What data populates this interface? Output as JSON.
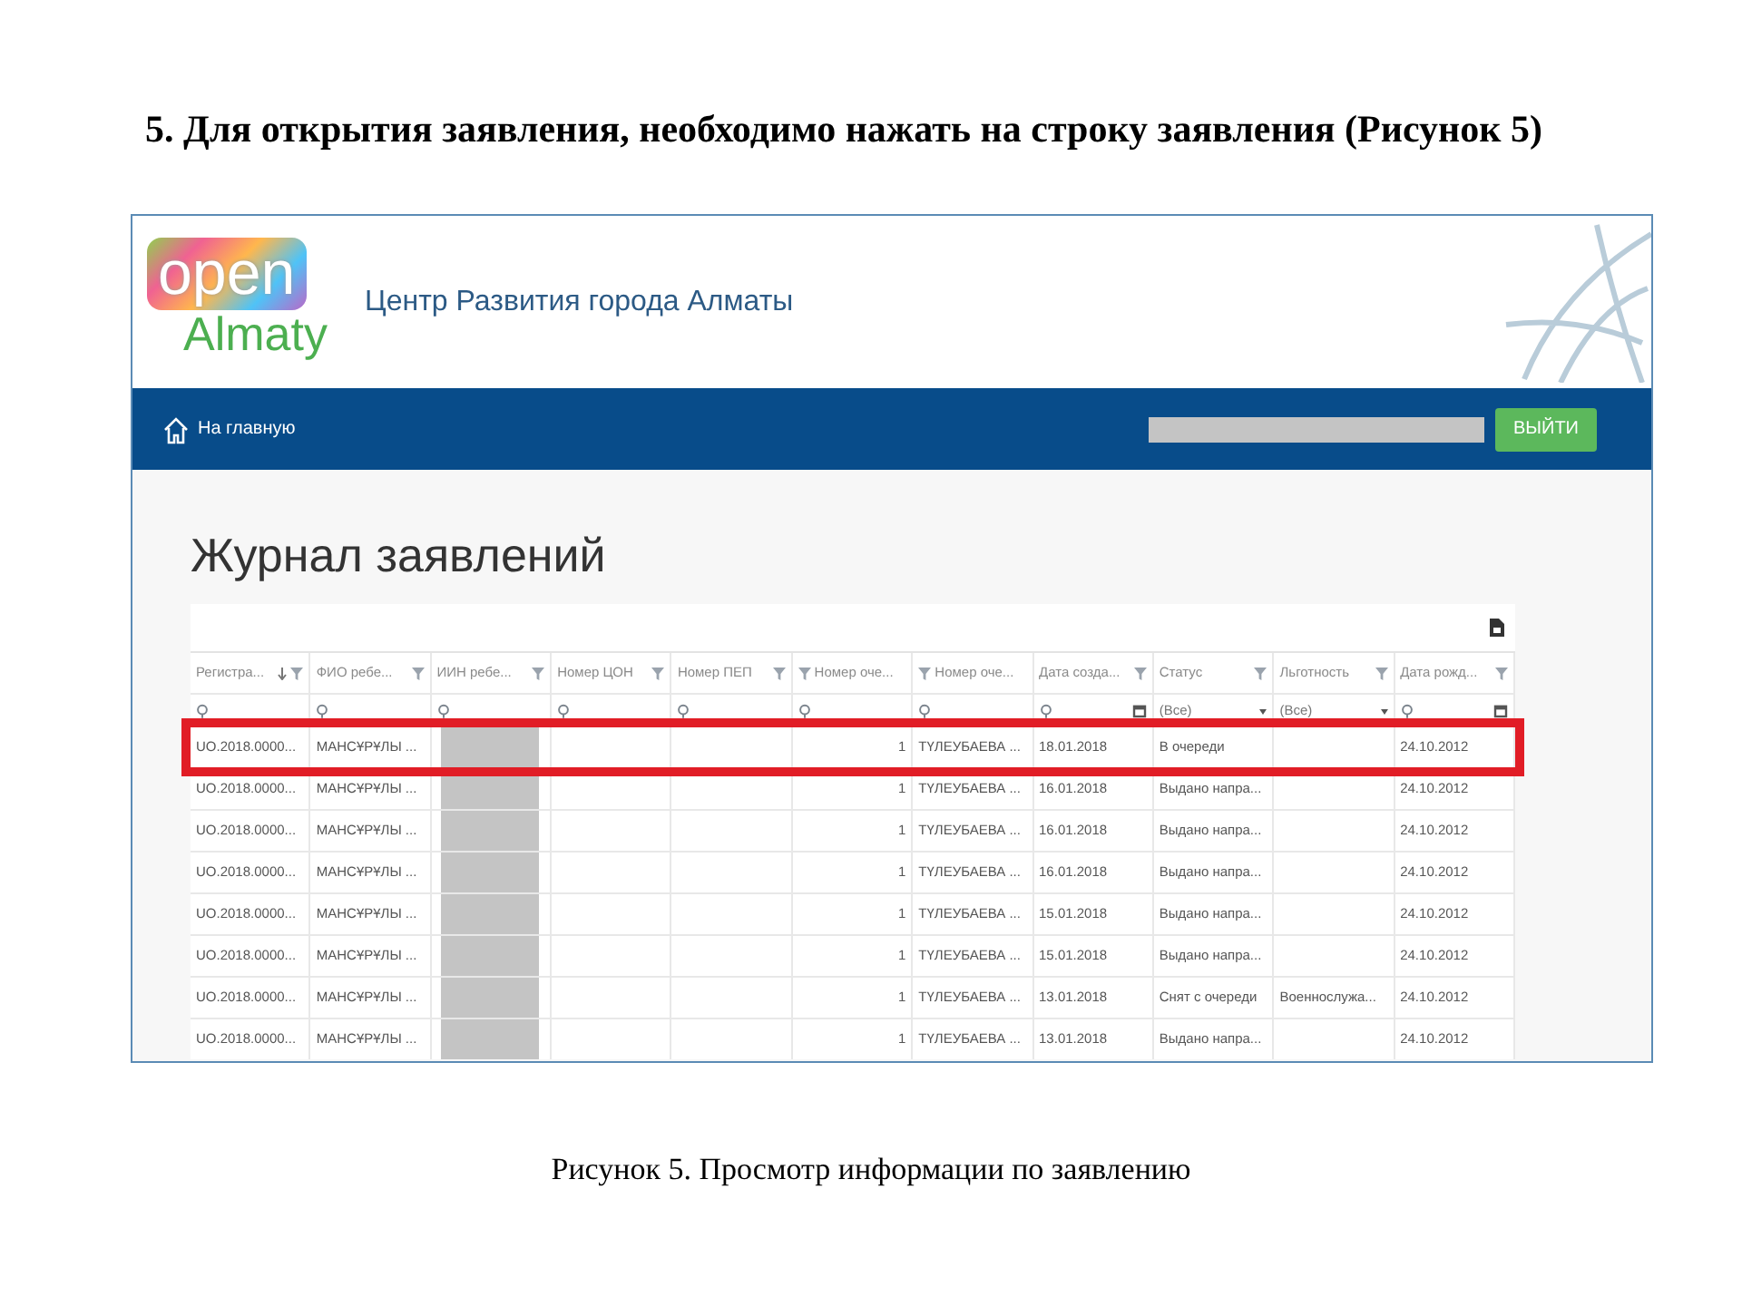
{
  "heading": "5. Для открытия заявления, необходимо нажать на строку заявления (Рисунок 5)",
  "screenshot": {
    "logo": {
      "top": "open",
      "bottom": "Almaty"
    },
    "site_title": "Центр Развития города Алматы",
    "nav": {
      "home_link": "На главную",
      "logout_button": "ВЫЙТИ"
    },
    "page_title": "Журнал заявлений",
    "table": {
      "columns": [
        {
          "label": "Регистра...",
          "sorted": true,
          "filter_left": false
        },
        {
          "label": "ФИО ребе...",
          "sorted": false,
          "filter_left": false
        },
        {
          "label": "ИИН ребе...",
          "sorted": false,
          "filter_left": false
        },
        {
          "label": "Номер ЦОН",
          "sorted": false,
          "filter_left": false
        },
        {
          "label": "Номер ПЕП",
          "sorted": false,
          "filter_left": false
        },
        {
          "label": "Номер оче...",
          "sorted": false,
          "filter_left": true
        },
        {
          "label": "Номер оче...",
          "sorted": false,
          "filter_left": true
        },
        {
          "label": "Дата созда...",
          "sorted": false,
          "filter_left": false
        },
        {
          "label": "Статус",
          "sorted": false,
          "filter_left": false
        },
        {
          "label": "Льготность",
          "sorted": false,
          "filter_left": false
        },
        {
          "label": "Дата рожд...",
          "sorted": false,
          "filter_left": false
        }
      ],
      "filters": [
        {
          "kind": "search"
        },
        {
          "kind": "search"
        },
        {
          "kind": "search"
        },
        {
          "kind": "search"
        },
        {
          "kind": "search"
        },
        {
          "kind": "search"
        },
        {
          "kind": "search"
        },
        {
          "kind": "date"
        },
        {
          "kind": "select",
          "value": "(Все)"
        },
        {
          "kind": "select",
          "value": "(Все)"
        },
        {
          "kind": "date"
        }
      ],
      "rows": [
        {
          "selected": true,
          "iin_redacted": true,
          "cells": [
            "UO.2018.0000...",
            "МАНСҰРҰЛЫ ...",
            "",
            "",
            "",
            "1",
            "ТҮЛЕУБАЕВА ...",
            "18.01.2018",
            "В очереди",
            "",
            "24.10.2012"
          ]
        },
        {
          "selected": false,
          "iin_redacted": true,
          "cells": [
            "UO.2018.0000...",
            "МАНСҰРҰЛЫ ...",
            "",
            "",
            "",
            "1",
            "ТҮЛЕУБАЕВА ...",
            "16.01.2018",
            "Выдано напра...",
            "",
            "24.10.2012"
          ]
        },
        {
          "selected": false,
          "iin_redacted": true,
          "cells": [
            "UO.2018.0000...",
            "МАНСҰРҰЛЫ ...",
            "",
            "",
            "",
            "1",
            "ТҮЛЕУБАЕВА ...",
            "16.01.2018",
            "Выдано напра...",
            "",
            "24.10.2012"
          ]
        },
        {
          "selected": false,
          "iin_redacted": true,
          "cells": [
            "UO.2018.0000...",
            "МАНСҰРҰЛЫ ...",
            "",
            "",
            "",
            "1",
            "ТҮЛЕУБАЕВА ...",
            "16.01.2018",
            "Выдано напра...",
            "",
            "24.10.2012"
          ]
        },
        {
          "selected": false,
          "iin_redacted": true,
          "cells": [
            "UO.2018.0000...",
            "МАНСҰРҰЛЫ ...",
            "",
            "",
            "",
            "1",
            "ТҮЛЕУБАЕВА ...",
            "15.01.2018",
            "Выдано напра...",
            "",
            "24.10.2012"
          ]
        },
        {
          "selected": false,
          "iin_redacted": true,
          "cells": [
            "UO.2018.0000...",
            "МАНСҰРҰЛЫ ...",
            "",
            "",
            "",
            "1",
            "ТҮЛЕУБАЕВА ...",
            "15.01.2018",
            "Выдано напра...",
            "",
            "24.10.2012"
          ]
        },
        {
          "selected": false,
          "iin_redacted": true,
          "cells": [
            "UO.2018.0000...",
            "МАНСҰРҰЛЫ ...",
            "",
            "",
            "",
            "1",
            "ТҮЛЕУБАЕВА ...",
            "13.01.2018",
            "Снят с очереди",
            "Военнослужа...",
            "24.10.2012"
          ]
        },
        {
          "selected": false,
          "iin_redacted": true,
          "cells": [
            "UO.2018.0000...",
            "МАНСҰРҰЛЫ ...",
            "",
            "",
            "",
            "1",
            "ТҮЛЕУБАЕВА ...",
            "13.01.2018",
            "Выдано напра...",
            "",
            "24.10.2012"
          ]
        }
      ]
    }
  },
  "caption": "Рисунок 5. Просмотр информации по заявлению"
}
